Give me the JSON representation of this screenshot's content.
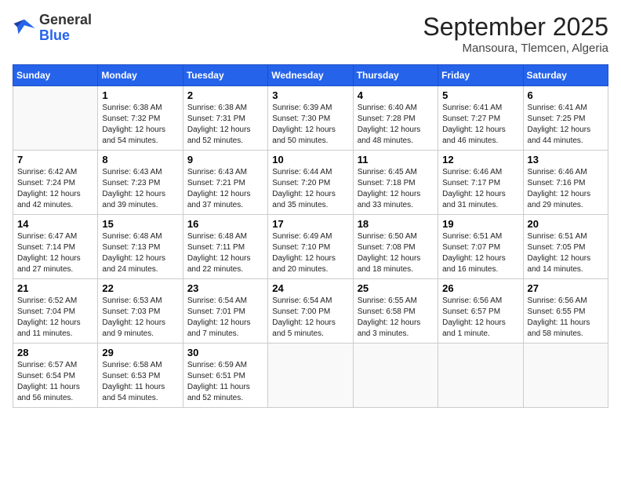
{
  "logo": {
    "line1": "General",
    "line2": "Blue"
  },
  "title": "September 2025",
  "location": "Mansoura, Tlemcen, Algeria",
  "days_of_week": [
    "Sunday",
    "Monday",
    "Tuesday",
    "Wednesday",
    "Thursday",
    "Friday",
    "Saturday"
  ],
  "weeks": [
    [
      {
        "day": "",
        "sunrise": "",
        "sunset": "",
        "daylight": ""
      },
      {
        "day": "1",
        "sunrise": "Sunrise: 6:38 AM",
        "sunset": "Sunset: 7:32 PM",
        "daylight": "Daylight: 12 hours and 54 minutes."
      },
      {
        "day": "2",
        "sunrise": "Sunrise: 6:38 AM",
        "sunset": "Sunset: 7:31 PM",
        "daylight": "Daylight: 12 hours and 52 minutes."
      },
      {
        "day": "3",
        "sunrise": "Sunrise: 6:39 AM",
        "sunset": "Sunset: 7:30 PM",
        "daylight": "Daylight: 12 hours and 50 minutes."
      },
      {
        "day": "4",
        "sunrise": "Sunrise: 6:40 AM",
        "sunset": "Sunset: 7:28 PM",
        "daylight": "Daylight: 12 hours and 48 minutes."
      },
      {
        "day": "5",
        "sunrise": "Sunrise: 6:41 AM",
        "sunset": "Sunset: 7:27 PM",
        "daylight": "Daylight: 12 hours and 46 minutes."
      },
      {
        "day": "6",
        "sunrise": "Sunrise: 6:41 AM",
        "sunset": "Sunset: 7:25 PM",
        "daylight": "Daylight: 12 hours and 44 minutes."
      }
    ],
    [
      {
        "day": "7",
        "sunrise": "Sunrise: 6:42 AM",
        "sunset": "Sunset: 7:24 PM",
        "daylight": "Daylight: 12 hours and 42 minutes."
      },
      {
        "day": "8",
        "sunrise": "Sunrise: 6:43 AM",
        "sunset": "Sunset: 7:23 PM",
        "daylight": "Daylight: 12 hours and 39 minutes."
      },
      {
        "day": "9",
        "sunrise": "Sunrise: 6:43 AM",
        "sunset": "Sunset: 7:21 PM",
        "daylight": "Daylight: 12 hours and 37 minutes."
      },
      {
        "day": "10",
        "sunrise": "Sunrise: 6:44 AM",
        "sunset": "Sunset: 7:20 PM",
        "daylight": "Daylight: 12 hours and 35 minutes."
      },
      {
        "day": "11",
        "sunrise": "Sunrise: 6:45 AM",
        "sunset": "Sunset: 7:18 PM",
        "daylight": "Daylight: 12 hours and 33 minutes."
      },
      {
        "day": "12",
        "sunrise": "Sunrise: 6:46 AM",
        "sunset": "Sunset: 7:17 PM",
        "daylight": "Daylight: 12 hours and 31 minutes."
      },
      {
        "day": "13",
        "sunrise": "Sunrise: 6:46 AM",
        "sunset": "Sunset: 7:16 PM",
        "daylight": "Daylight: 12 hours and 29 minutes."
      }
    ],
    [
      {
        "day": "14",
        "sunrise": "Sunrise: 6:47 AM",
        "sunset": "Sunset: 7:14 PM",
        "daylight": "Daylight: 12 hours and 27 minutes."
      },
      {
        "day": "15",
        "sunrise": "Sunrise: 6:48 AM",
        "sunset": "Sunset: 7:13 PM",
        "daylight": "Daylight: 12 hours and 24 minutes."
      },
      {
        "day": "16",
        "sunrise": "Sunrise: 6:48 AM",
        "sunset": "Sunset: 7:11 PM",
        "daylight": "Daylight: 12 hours and 22 minutes."
      },
      {
        "day": "17",
        "sunrise": "Sunrise: 6:49 AM",
        "sunset": "Sunset: 7:10 PM",
        "daylight": "Daylight: 12 hours and 20 minutes."
      },
      {
        "day": "18",
        "sunrise": "Sunrise: 6:50 AM",
        "sunset": "Sunset: 7:08 PM",
        "daylight": "Daylight: 12 hours and 18 minutes."
      },
      {
        "day": "19",
        "sunrise": "Sunrise: 6:51 AM",
        "sunset": "Sunset: 7:07 PM",
        "daylight": "Daylight: 12 hours and 16 minutes."
      },
      {
        "day": "20",
        "sunrise": "Sunrise: 6:51 AM",
        "sunset": "Sunset: 7:05 PM",
        "daylight": "Daylight: 12 hours and 14 minutes."
      }
    ],
    [
      {
        "day": "21",
        "sunrise": "Sunrise: 6:52 AM",
        "sunset": "Sunset: 7:04 PM",
        "daylight": "Daylight: 12 hours and 11 minutes."
      },
      {
        "day": "22",
        "sunrise": "Sunrise: 6:53 AM",
        "sunset": "Sunset: 7:03 PM",
        "daylight": "Daylight: 12 hours and 9 minutes."
      },
      {
        "day": "23",
        "sunrise": "Sunrise: 6:54 AM",
        "sunset": "Sunset: 7:01 PM",
        "daylight": "Daylight: 12 hours and 7 minutes."
      },
      {
        "day": "24",
        "sunrise": "Sunrise: 6:54 AM",
        "sunset": "Sunset: 7:00 PM",
        "daylight": "Daylight: 12 hours and 5 minutes."
      },
      {
        "day": "25",
        "sunrise": "Sunrise: 6:55 AM",
        "sunset": "Sunset: 6:58 PM",
        "daylight": "Daylight: 12 hours and 3 minutes."
      },
      {
        "day": "26",
        "sunrise": "Sunrise: 6:56 AM",
        "sunset": "Sunset: 6:57 PM",
        "daylight": "Daylight: 12 hours and 1 minute."
      },
      {
        "day": "27",
        "sunrise": "Sunrise: 6:56 AM",
        "sunset": "Sunset: 6:55 PM",
        "daylight": "Daylight: 11 hours and 58 minutes."
      }
    ],
    [
      {
        "day": "28",
        "sunrise": "Sunrise: 6:57 AM",
        "sunset": "Sunset: 6:54 PM",
        "daylight": "Daylight: 11 hours and 56 minutes."
      },
      {
        "day": "29",
        "sunrise": "Sunrise: 6:58 AM",
        "sunset": "Sunset: 6:53 PM",
        "daylight": "Daylight: 11 hours and 54 minutes."
      },
      {
        "day": "30",
        "sunrise": "Sunrise: 6:59 AM",
        "sunset": "Sunset: 6:51 PM",
        "daylight": "Daylight: 11 hours and 52 minutes."
      },
      {
        "day": "",
        "sunrise": "",
        "sunset": "",
        "daylight": ""
      },
      {
        "day": "",
        "sunrise": "",
        "sunset": "",
        "daylight": ""
      },
      {
        "day": "",
        "sunrise": "",
        "sunset": "",
        "daylight": ""
      },
      {
        "day": "",
        "sunrise": "",
        "sunset": "",
        "daylight": ""
      }
    ]
  ]
}
